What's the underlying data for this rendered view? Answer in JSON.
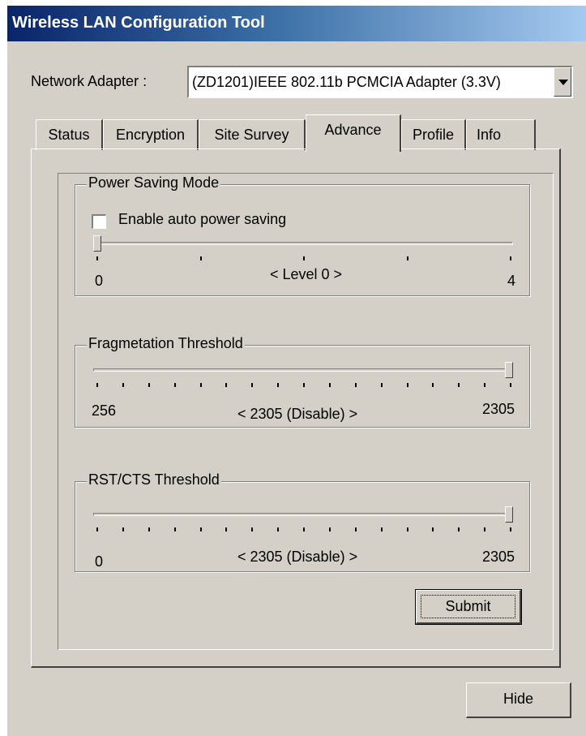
{
  "window": {
    "title": "Wireless LAN Configuration Tool"
  },
  "adapter": {
    "label": "Network Adapter :",
    "value": "(ZD1201)IEEE 802.11b PCMCIA Adapter (3.3V)"
  },
  "tabs": [
    {
      "label": "Status",
      "active": false
    },
    {
      "label": "Encryption",
      "active": false
    },
    {
      "label": "Site Survey",
      "active": false
    },
    {
      "label": "Advance",
      "active": true
    },
    {
      "label": "Profile",
      "active": false
    },
    {
      "label": "Info",
      "active": false
    }
  ],
  "power_saving": {
    "title": "Power Saving Mode",
    "checkbox_label": "Enable auto power saving",
    "checked": false,
    "min_label": "0",
    "max_label": "4",
    "level_text": "< Level 0 >",
    "value": 0,
    "min": 0,
    "max": 4
  },
  "fragmentation": {
    "title": "Fragmetation Threshold",
    "min_label": "256",
    "max_label": "2305",
    "value_text": "< 2305 (Disable) >",
    "value": 2305,
    "min": 256,
    "max": 2305
  },
  "rts_cts": {
    "title": "RST/CTS Threshold",
    "min_label": "0",
    "max_label": "2305",
    "value_text": "< 2305 (Disable) >",
    "value": 2305,
    "min": 0,
    "max": 2305
  },
  "buttons": {
    "submit": "Submit",
    "hide": "Hide"
  },
  "icons": {
    "dropdown": "chevron-down-icon",
    "checkbox": "checkbox-unchecked-icon"
  }
}
